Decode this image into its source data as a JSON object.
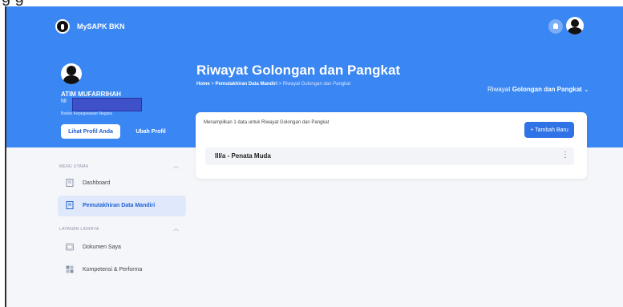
{
  "cropped_heading": "g         g",
  "app": {
    "title": "MySAPK BKN"
  },
  "profile": {
    "name": "ATIM MUFARRIHAH",
    "nip_prefix": "NI",
    "agency": "Badan Kepegawaian Negara",
    "view_profile_label": "Lihat Profil Anda",
    "edit_profile_label": "Ubah Profil"
  },
  "page": {
    "title": "Riwayat Golongan dan Pangkat",
    "breadcrumb": {
      "home": "Home",
      "sep": ">",
      "mid": "Pemutakhiran Data Mandiri",
      "current": "Riwayat Golongan dan Pangkat"
    },
    "dropdown_prefix": "Riwayat",
    "dropdown_bold": "Golongan dan Pangkat",
    "dropdown_caret": "⌄"
  },
  "card": {
    "info": "Menampilkan 1 data untuk Riwayat Golongan dan Pangkat",
    "add_button": "+ Tambah Baru",
    "rows": [
      {
        "label": "III/a - Penata Muda",
        "more": "⋮"
      }
    ]
  },
  "sidebar": {
    "section_main": "MENU UTAMA",
    "section_other": "LAYANAN LAINNYA",
    "toggle": "︿",
    "items": [
      {
        "label": "Dashboard",
        "icon": "document-icon"
      },
      {
        "label": "Pemutakhiran Data Mandiri",
        "icon": "document-icon",
        "active": true
      },
      {
        "label": "Dokumen Saya",
        "icon": "folder-icon"
      },
      {
        "label": "Kompetensi & Performa",
        "icon": "grid-icon"
      }
    ]
  },
  "colors": {
    "primary": "#3a86f2",
    "button": "#2f73e6",
    "active_bg": "#dfe9fb"
  }
}
